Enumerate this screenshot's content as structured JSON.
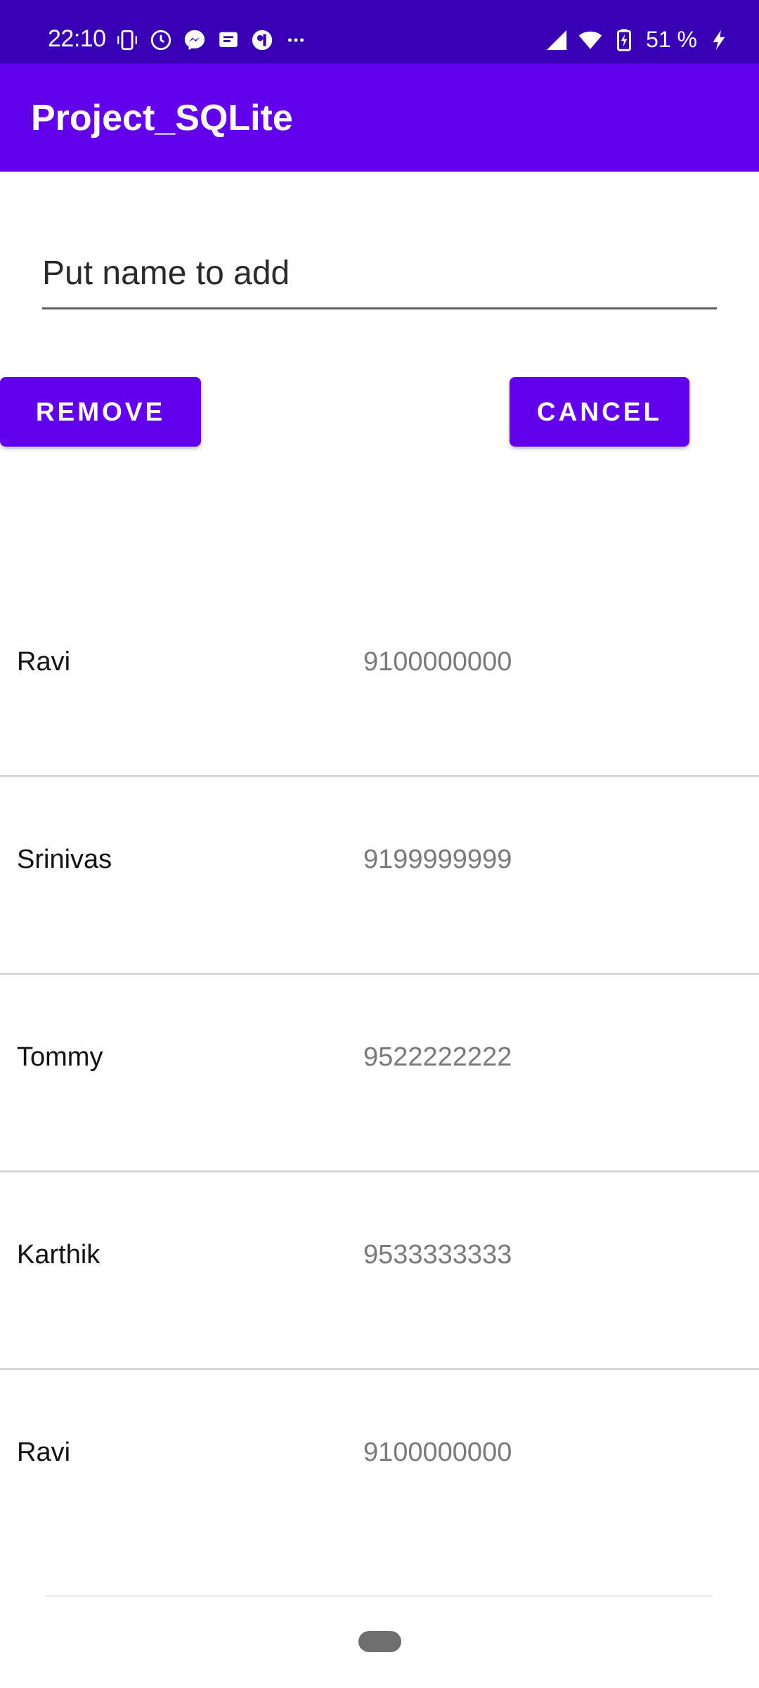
{
  "status_bar": {
    "time": "22:10",
    "battery_text": "51 %",
    "icons_left": [
      "phone-vibrate-icon",
      "alarm-icon",
      "messenger-icon",
      "message-icon",
      "app-notification-icon",
      "more-dots-icon"
    ],
    "icons_right": [
      "signal-icon",
      "wifi-icon",
      "battery-charging-icon",
      "charging-bolt-icon"
    ],
    "background": "#3700b3"
  },
  "app_bar": {
    "title": "Project_SQLite",
    "background": "#6200ee"
  },
  "form": {
    "name_placeholder": "Put name to add",
    "name_value": "",
    "remove_label": "REMOVE",
    "cancel_label": "CANCEL",
    "button_color": "#6200ee"
  },
  "list": {
    "rows": [
      {
        "name": "Ravi",
        "phone": "9100000000"
      },
      {
        "name": "Srinivas",
        "phone": "9199999999"
      },
      {
        "name": "Tommy",
        "phone": "9522222222"
      },
      {
        "name": "Karthik",
        "phone": "9533333333"
      },
      {
        "name": "Ravi",
        "phone": "9100000000"
      }
    ]
  }
}
